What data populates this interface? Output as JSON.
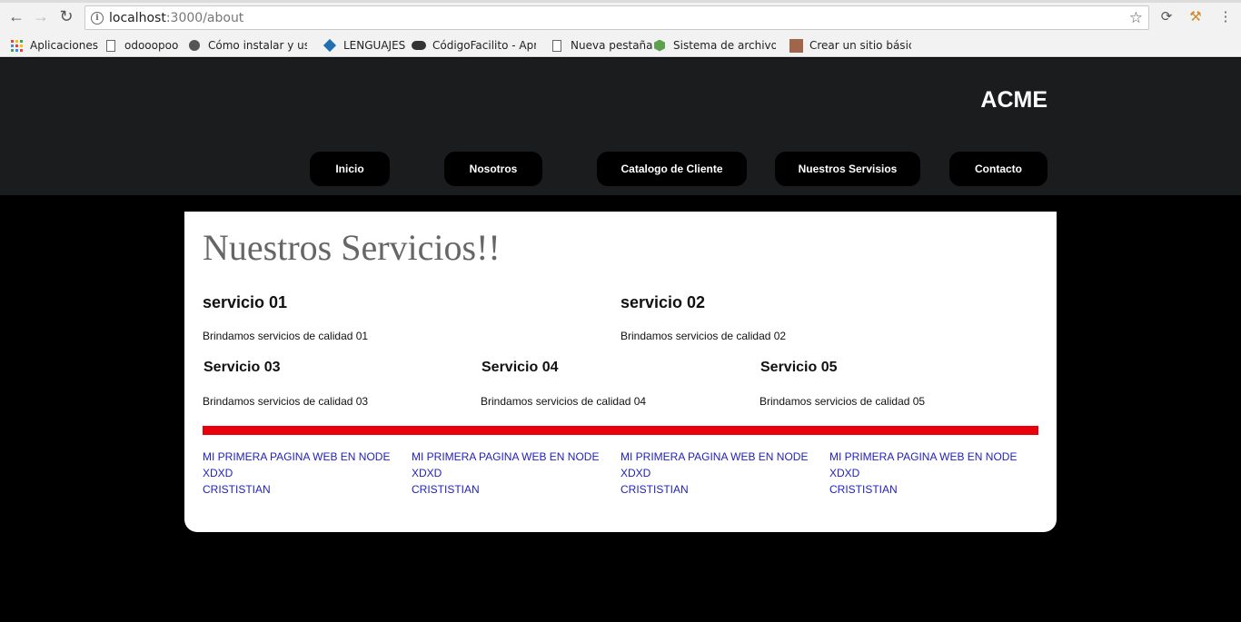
{
  "browser": {
    "url_host": "localhost",
    "url_path": ":3000/about",
    "bookmarks": [
      {
        "label": "Aplicaciones",
        "icon": "apps-grid-icon"
      },
      {
        "label": "odooopoo",
        "icon": "page-icon"
      },
      {
        "label": "Cómo instalar y usar ",
        "icon": "avatar-icon"
      },
      {
        "label": "LENGUAJES",
        "icon": "diamond-icon"
      },
      {
        "label": "CódigoFacilito - Apre",
        "icon": "codigofacilito-icon"
      },
      {
        "label": "Nueva pestaña",
        "icon": "page-icon"
      },
      {
        "label": "Sistema de archivos |",
        "icon": "nodejs-icon"
      },
      {
        "label": "Crear un sitio básico",
        "icon": "photo-icon"
      }
    ]
  },
  "header": {
    "brand": "ACME",
    "nav": [
      "Inicio",
      "Nosotros",
      "Catalogo de Cliente",
      "Nuestros Servisios",
      "Contacto"
    ]
  },
  "main": {
    "title": "Nuestros Servicios!!",
    "services": [
      {
        "title": "servicio 01",
        "text": "Brindamos servicios de calidad 01"
      },
      {
        "title": "servicio 02",
        "text": "Brindamos servicios de calidad 02"
      },
      {
        "title": "Servicio 03",
        "text": "Brindamos servicios de calidad 03"
      },
      {
        "title": "Servicio 04",
        "text": "Brindamos servicios de calidad 04"
      },
      {
        "title": "Servicio 05",
        "text": "Brindamos servicios de calidad 05"
      }
    ]
  },
  "footer": {
    "columns": [
      {
        "line1": "MI PRIMERA PAGINA WEB EN NODE",
        "line2": "XDXD",
        "line3": "CRISTISTIAN"
      },
      {
        "line1": "MI PRIMERA PAGINA WEB EN NODE",
        "line2": "XDXD",
        "line3": "CRISTISTIAN"
      },
      {
        "line1": "MI PRIMERA PAGINA WEB EN NODE",
        "line2": "XDXD",
        "line3": "CRISTISTIAN"
      },
      {
        "line1": "MI PRIMERA PAGINA WEB EN NODE",
        "line2": "XDXD",
        "line3": "CRISTISTIAN"
      }
    ]
  },
  "colors": {
    "header_bg": "#1b1c1e",
    "page_bg": "#000000",
    "accent_bar": "#e8000b",
    "link": "#2222bb"
  }
}
